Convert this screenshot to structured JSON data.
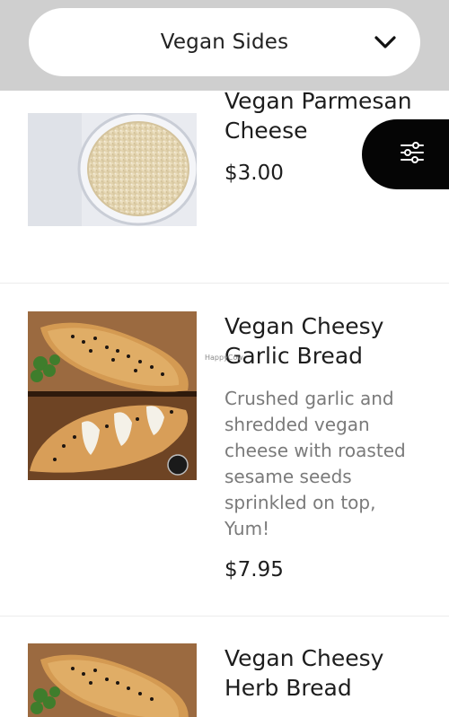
{
  "header": {
    "category": "Vegan Sides",
    "dropdown_icon": "chevron-down-icon"
  },
  "filter": {
    "icon": "sliders-icon"
  },
  "items": [
    {
      "title_line1": "Vegan Parmesan",
      "title_line2": "Cheese",
      "price": "$3.00"
    },
    {
      "title_line1": "Vegan Cheesy",
      "title_line2": "Garlic Bread",
      "desc_lines": [
        "Crushed garlic and",
        "shredded vegan",
        "cheese with roasted",
        "sesame seeds",
        "sprinkled on top,",
        "Yum!"
      ],
      "price": "$7.95"
    },
    {
      "title_line1": "Vegan Cheesy",
      "title_line2": "Herb Bread"
    }
  ],
  "watermark": "HappyCow"
}
